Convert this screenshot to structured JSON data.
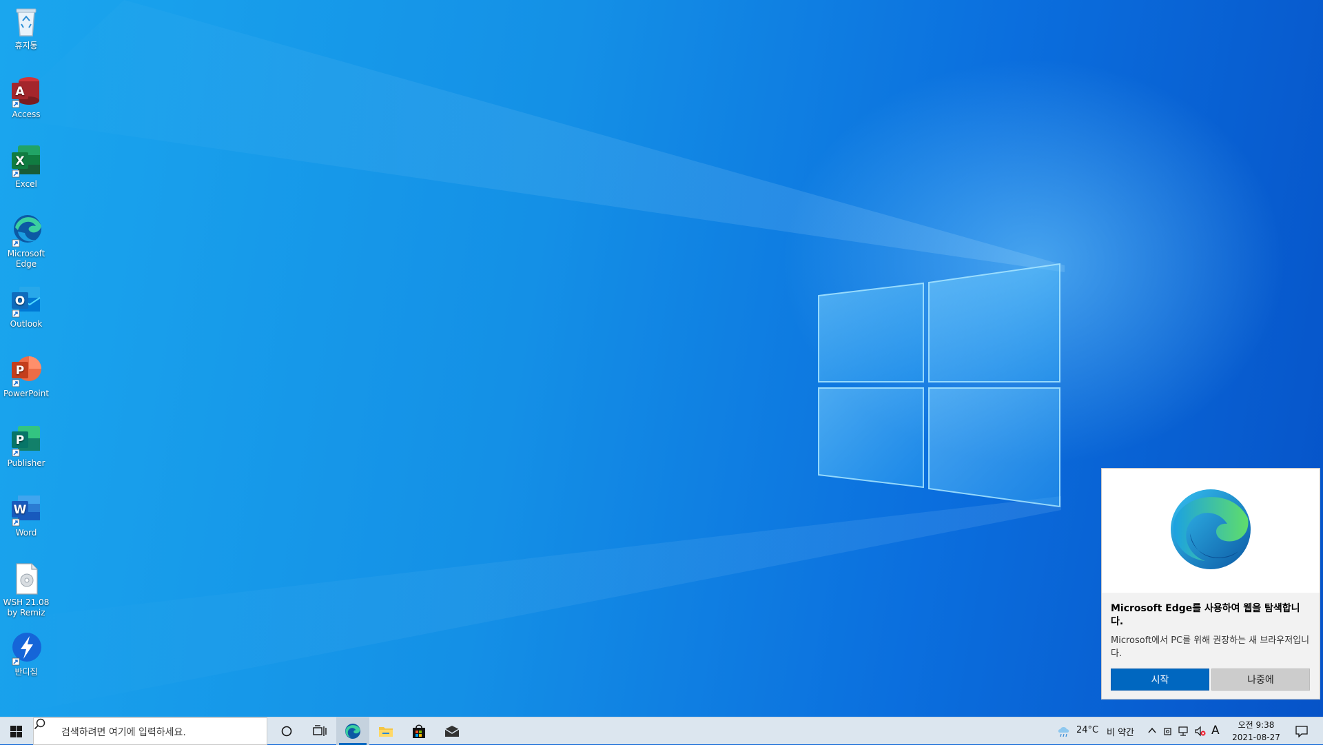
{
  "desktop": {
    "icons": [
      {
        "label": "휴지통",
        "icon": "recycle-bin-icon"
      },
      {
        "label": "Access",
        "icon": "access-icon",
        "color": "#a4262c"
      },
      {
        "label": "Excel",
        "icon": "excel-icon",
        "color": "#107c41"
      },
      {
        "label": "Microsoft Edge",
        "icon": "edge-icon"
      },
      {
        "label": "Outlook",
        "icon": "outlook-icon",
        "color": "#0f6cbd"
      },
      {
        "label": "PowerPoint",
        "icon": "powerpoint-icon",
        "color": "#c43e1c"
      },
      {
        "label": "Publisher",
        "icon": "publisher-icon",
        "color": "#077568"
      },
      {
        "label": "Word",
        "icon": "word-icon",
        "color": "#185abd"
      },
      {
        "label": "WSH 21.08 by Remiz",
        "icon": "document-icon"
      },
      {
        "label": "반디집",
        "icon": "bandizip-icon",
        "color": "#1565d8"
      }
    ]
  },
  "toast": {
    "title": "Microsoft Edge를 사용하여 웹을 탐색합니다.",
    "body": "Microsoft에서 PC를 위해 권장하는 새 브라우저입니다.",
    "primary_button": "시작",
    "secondary_button": "나중에"
  },
  "taskbar": {
    "search_placeholder": "검색하려면 여기에 입력하세요.",
    "weather_temp": "24°C",
    "weather_desc": "비 약간",
    "ime": "A",
    "clock_time": "오전 9:38",
    "clock_date": "2021-08-27"
  },
  "colors": {
    "accent": "#0067c0",
    "taskbar": "#dce6ef",
    "desktop": "#0a63d6"
  }
}
